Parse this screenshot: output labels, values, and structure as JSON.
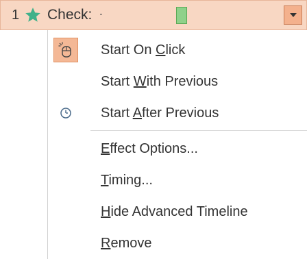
{
  "animation_row": {
    "number": "1",
    "name": "Check:",
    "dot": "·",
    "star_icon": "star-icon",
    "dropdown_icon": "chevron-down-icon",
    "timeline_color": "#8fd18a"
  },
  "menu": {
    "items": [
      {
        "pre": "Start On ",
        "key": "C",
        "post": "lick",
        "icon": "mouse-click-icon",
        "checked": true
      },
      {
        "pre": "Start ",
        "key": "W",
        "post": "ith Previous",
        "icon": "",
        "checked": false
      },
      {
        "pre": "Start ",
        "key": "A",
        "post": "fter Previous",
        "icon": "clock-icon",
        "checked": false
      },
      {
        "pre": "",
        "key": "E",
        "post": "ffect Options...",
        "icon": "",
        "checked": false
      },
      {
        "pre": "",
        "key": "T",
        "post": "iming...",
        "icon": "",
        "checked": false
      },
      {
        "pre": "",
        "key": "H",
        "post": "ide Advanced Timeline",
        "icon": "",
        "checked": false
      },
      {
        "pre": "",
        "key": "R",
        "post": "emove",
        "icon": "",
        "checked": false
      }
    ]
  },
  "colors": {
    "row_background": "#f8d7c3",
    "accent": "#f4b896",
    "star": "#3fb18a"
  }
}
